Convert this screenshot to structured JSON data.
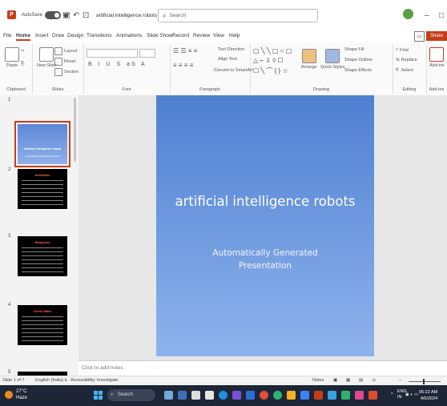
{
  "titlebar": {
    "app_icon": "P",
    "autosave_label": "AutoSave",
    "autosave_state": "Off",
    "undo_icon": "undo-icon",
    "redo_icon": "redo-icon",
    "doc_title": "artificial intelligence robots presenta... • Saved to this PC ∨",
    "search_placeholder": "Search",
    "minimize": "–",
    "restore": "□"
  },
  "menu": {
    "items": [
      "File",
      "Home",
      "Insert",
      "Draw",
      "Design",
      "Transitions",
      "Animations",
      "Slide Show",
      "Record",
      "Review",
      "View",
      "Help"
    ],
    "active": "Home",
    "share_label": "Share",
    "comments_icon": "comment-icon"
  },
  "ribbon": {
    "groups": [
      "Clipboard",
      "Slides",
      "Font",
      "Paragraph",
      "Drawing",
      "Editing",
      "Add-ins"
    ],
    "clipboard": {
      "paste": "Paste"
    },
    "slides": {
      "new_slide": "New Slide",
      "layout": "Layout",
      "reset": "Reset",
      "section": "Section"
    },
    "paragraph": {
      "text_direction": "Text Direction",
      "align_text": "Align Text",
      "smartart": "Convert to SmartArt"
    },
    "drawing": {
      "arrange": "Arrange",
      "quick_styles": "Quick Styles",
      "shape_fill": "Shape Fill",
      "shape_outline": "Shape Outline",
      "shape_effects": "Shape Effects"
    },
    "editing": {
      "find": "Find",
      "replace": "Replace",
      "select": "Select"
    },
    "addins": {
      "label": "Add-ins"
    }
  },
  "slides_pane": {
    "thumbs": [
      {
        "num": "1",
        "title": "artificial intelligence robots",
        "sub": "Automatically Generated Presentation"
      },
      {
        "num": "2",
        "title": "Introduction"
      },
      {
        "num": "3",
        "title": "Background"
      },
      {
        "num": "4",
        "title": "Current Status"
      },
      {
        "num": "5",
        "title": ""
      }
    ]
  },
  "slide": {
    "title": "artificial intelligence robots",
    "subtitle_line1": "Automatically Generated",
    "subtitle_line2": "Presentation"
  },
  "notes_placeholder": "Click to add notes",
  "status": {
    "slide_count": "Slide 1 of 7",
    "language": "English (India)",
    "accessibility": "Accessibility: Investigate",
    "notes_btn": "Notes"
  },
  "taskbar": {
    "temp": "27°C",
    "weather": "Haze",
    "search": "Search",
    "lang": "ENG",
    "lang2": "IN",
    "time": "05:22 AM",
    "date": "4/5/2024"
  }
}
